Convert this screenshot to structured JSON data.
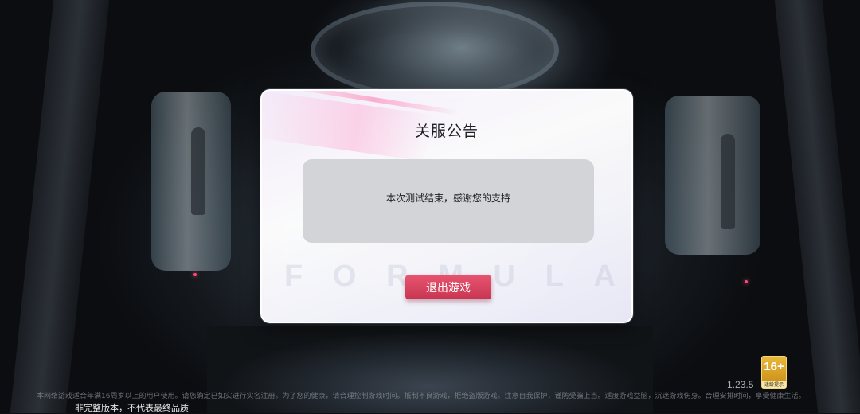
{
  "dialog": {
    "title": "关服公告",
    "message": "本次测试结束，感谢您的支持",
    "exit_button_label": "退出游戏",
    "watermark_letters": [
      "F",
      "O",
      "R",
      "M",
      "U",
      "L",
      "A"
    ]
  },
  "footer": {
    "version": "1.23.5",
    "age_rating": "16+",
    "age_rating_label": "适龄提示",
    "health_notice": "本网络游戏适合年满16周岁以上的用户使用。请您确定已如实进行实名注册。为了您的健康，请合理控制游戏时间。抵制不良游戏，拒绝盗版游戏。注意自我保护，谨防受骗上当。适度游戏益脑，沉迷游戏伤身。合理安排时间，享受健康生活。",
    "incomplete_notice": "非完整版本，不代表最终品质"
  },
  "colors": {
    "exit_button": "#d8435f",
    "message_box": "#d3d4d8",
    "age_badge": "#e0a82a"
  }
}
